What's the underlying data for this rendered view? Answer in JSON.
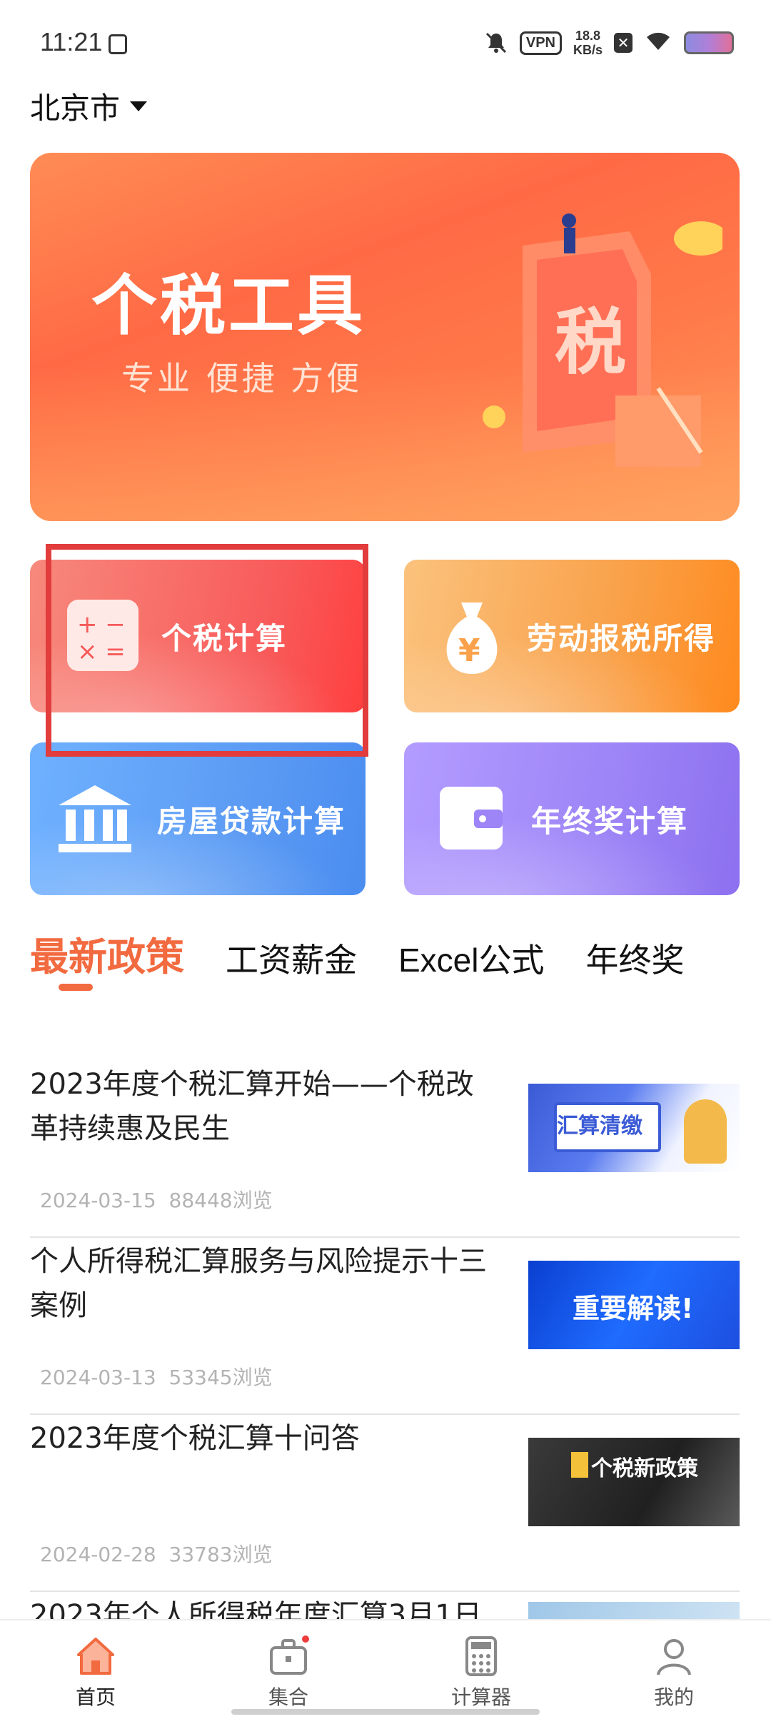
{
  "status_bar": {
    "time": "11:21",
    "vpn": "VPN",
    "speed_value": "18.8",
    "speed_unit": "KB/s"
  },
  "location": {
    "city": "北京市"
  },
  "banner": {
    "title": "个税工具",
    "subtitle": "专业 便捷 方便",
    "badge_char": "税"
  },
  "tools": [
    {
      "label": "个税计算",
      "icon": "calculator-icon"
    },
    {
      "label": "劳动报税所得",
      "icon": "money-bag-icon"
    },
    {
      "label": "房屋贷款计算",
      "icon": "bank-icon"
    },
    {
      "label": "年终奖计算",
      "icon": "wallet-icon"
    }
  ],
  "tabs": [
    {
      "label": "最新政策",
      "active": true
    },
    {
      "label": "工资薪金"
    },
    {
      "label": "Excel公式"
    },
    {
      "label": "年终奖"
    }
  ],
  "news": [
    {
      "title": "2023年度个税汇算开始——个税改革持续惠及民生",
      "date": "2024-03-15",
      "views": "88448浏览",
      "thumb_text": "汇算清缴"
    },
    {
      "title": "个人所得税汇算服务与风险提示十三案例",
      "date": "2024-03-13",
      "views": "53345浏览",
      "thumb_text": "重要解读!"
    },
    {
      "title": "2023年度个税汇算十问答",
      "date": "2024-02-28",
      "views": "33783浏览",
      "thumb_text": "个税新政策"
    },
    {
      "title": "2023年个人所得税年度汇算3月1日"
    }
  ],
  "bottom_nav": [
    {
      "label": "首页",
      "icon": "home-icon",
      "active": true
    },
    {
      "label": "集合",
      "icon": "briefcase-icon"
    },
    {
      "label": "计算器",
      "icon": "calculator-icon"
    },
    {
      "label": "我的",
      "icon": "user-icon"
    }
  ],
  "colors": {
    "accent": "#f26a3f",
    "highlight": "#e23c3c"
  }
}
